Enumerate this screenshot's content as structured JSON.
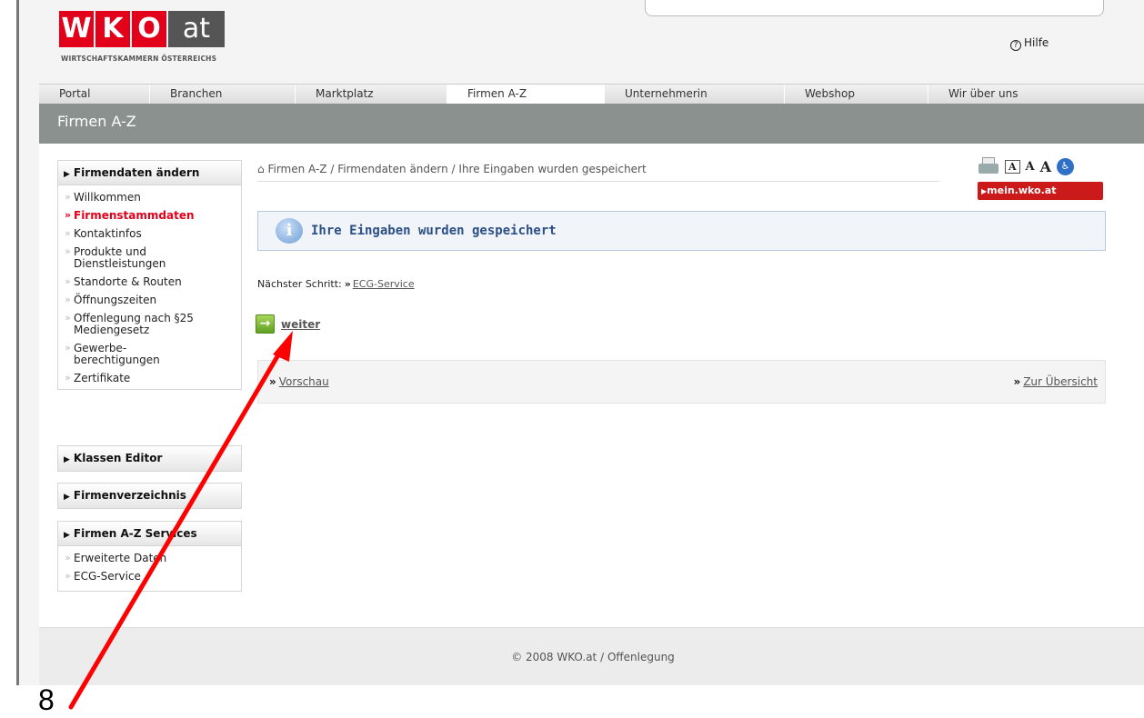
{
  "header": {
    "logo_letters": [
      "W",
      "K",
      "O"
    ],
    "logo_at": "at",
    "logo_subtitle": "WIRTSCHAFTSKAMMERN ÖSTERREICHS",
    "help_label": "Hilfe"
  },
  "nav": {
    "items": [
      "Portal",
      "Branchen",
      "Marktplatz",
      "Firmen A-Z",
      "Unternehmerin",
      "Webshop",
      "Wir über uns"
    ],
    "active": "Firmen A-Z"
  },
  "page_title": "Firmen A-Z",
  "sidebar": {
    "group1": {
      "title": "Firmendaten ändern",
      "items": [
        "Willkommen",
        "Firmenstammdaten",
        "Kontaktinfos",
        "Produkte und Dienstleistungen",
        "Standorte & Routen",
        "Öffnungszeiten",
        "Offenlegung nach §25 Mediengesetz",
        "Gewerbe-berechtigungen",
        "Zertifikate"
      ],
      "active": "Firmenstammdaten"
    },
    "group2": {
      "title": "Klassen Editor"
    },
    "group3": {
      "title": "Firmenverzeichnis"
    },
    "group4": {
      "title": "Firmen A-Z Services",
      "items": [
        "Erweiterte Daten",
        "ECG-Service"
      ]
    }
  },
  "breadcrumb": "Firmen A-Z / Firmendaten ändern / Ihre Eingaben wurden gespeichert",
  "tools": {
    "font_a": "A",
    "mein_wko": "mein.wko.at"
  },
  "notice": {
    "message": "Ihre Eingaben wurden gespeichert"
  },
  "next_step": {
    "label": "Nächster Schritt:",
    "link": "ECG-Service"
  },
  "weiter_label": "weiter",
  "bottom_links": {
    "preview": "Vorschau",
    "overview": "Zur Übersicht"
  },
  "footer": "© 2008 WKO.at / Offenlegung",
  "annotation": {
    "step_number": "8",
    "color": "#ff0000"
  }
}
